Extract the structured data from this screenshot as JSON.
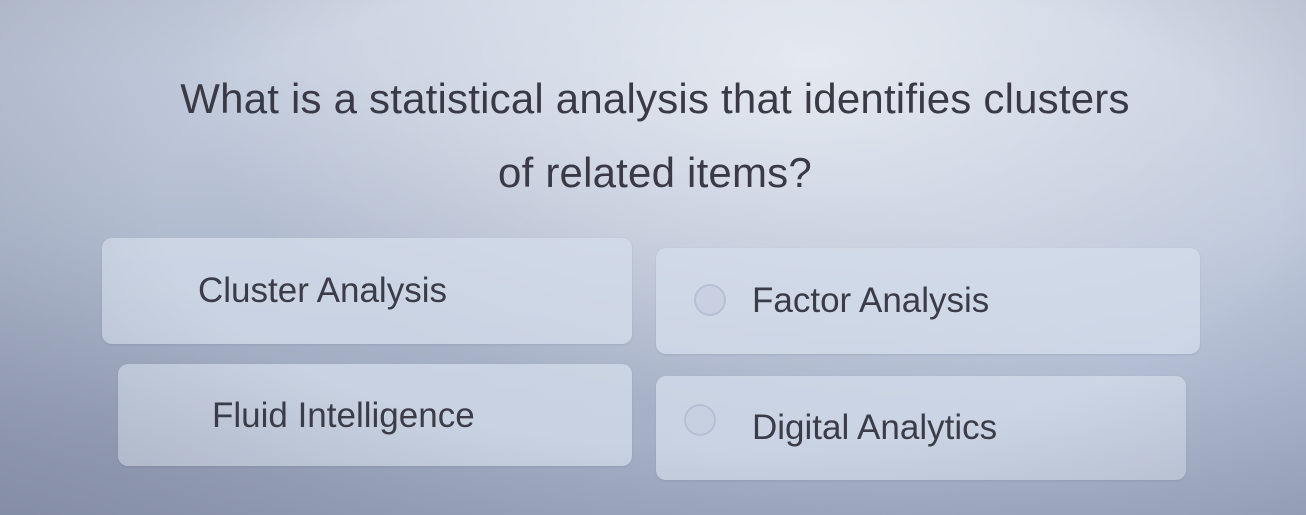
{
  "question": {
    "line1": "What is a statistical analysis that identifies clusters",
    "line2": "of related items?"
  },
  "options": [
    {
      "label": "Cluster Analysis"
    },
    {
      "label": "Factor Analysis"
    },
    {
      "label": "Fluid Intelligence"
    },
    {
      "label": "Digital Analytics"
    }
  ]
}
